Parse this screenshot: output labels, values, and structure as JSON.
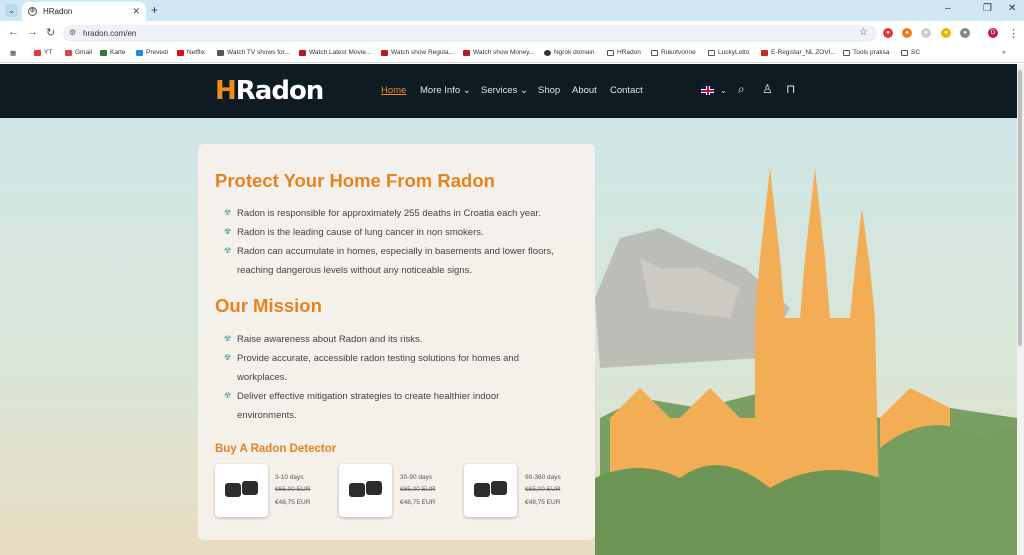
{
  "browser": {
    "tab_title": "HRadon",
    "url": "hradon.com/en",
    "bookmarks": [
      "YT",
      "Gmail",
      "Karte",
      "Prevedi",
      "Netflix",
      "Watch TV shows for...",
      "Watch Latest Movie...",
      "Watch show Regula...",
      "Watch show Money...",
      "Ngrok domain",
      "HRadon",
      "Rukotvorine",
      "LuckyLotto",
      "E-Registar_NL ZOVI...",
      "Tools praksa",
      "SC"
    ],
    "profile_initial": "D"
  },
  "site": {
    "logo_h": "H",
    "logo_rest": "Radon",
    "nav": [
      "Home",
      "More Info",
      "Services",
      "Shop",
      "About",
      "Contact"
    ],
    "colors": {
      "accent": "#f28c1c",
      "header_bg": "#0f1b23",
      "bullet": "#3a9e9a"
    }
  },
  "hero": {
    "title1": "Protect Your Home From Radon",
    "list1": [
      "Radon is responsible for approximately 255 deaths in Croatia each year.",
      "Radon is the leading cause of lung cancer in non smokers.",
      "Radon can accumulate in homes, especially in basements and lower floors, reaching dangerous levels without any noticeable signs."
    ],
    "title2": "Our Mission",
    "list2": [
      "Raise awareness about Radon and its risks.",
      "Provide accurate, accessible radon testing solutions for homes and workplaces.",
      "Deliver effective mitigation strategies to create healthier indoor environments."
    ],
    "buy_title": "Buy A Radon Detector",
    "products": [
      {
        "days": "3-10 days",
        "old": "€65,00 EUR",
        "price": "€48,75 EUR"
      },
      {
        "days": "30-90 days",
        "old": "€65,00 EUR",
        "price": "€48,75 EUR"
      },
      {
        "days": "90-360 days",
        "old": "€65,00 EUR",
        "price": "€48,75 EUR"
      }
    ]
  }
}
